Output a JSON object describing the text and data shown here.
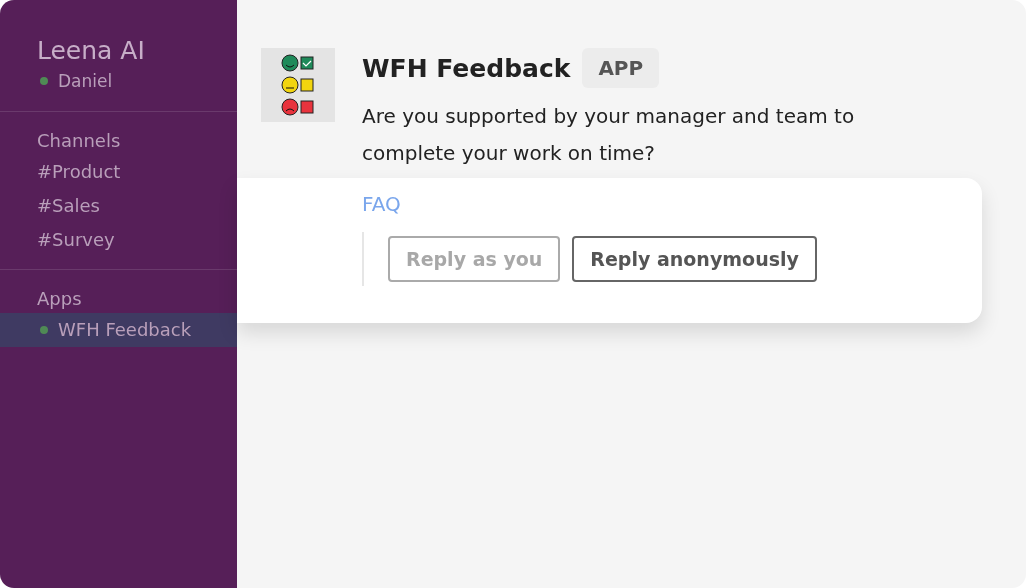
{
  "sidebar": {
    "workspace": "Leena AI",
    "user": {
      "name": "Daniel",
      "online": true
    },
    "sections": [
      {
        "title": "Channels",
        "items": [
          {
            "label": "#Product",
            "selected": false,
            "online": false
          },
          {
            "label": "#Sales",
            "selected": false,
            "online": false
          },
          {
            "label": "#Survey",
            "selected": false,
            "online": false
          }
        ]
      },
      {
        "title": "Apps",
        "items": [
          {
            "label": "WFH Feedback",
            "selected": true,
            "online": true
          }
        ]
      }
    ]
  },
  "message": {
    "sender": "WFH Feedback",
    "badge": "APP",
    "text": "Are you supported by your manager and team to complete your work on time?",
    "link": "FAQ",
    "buttons": [
      {
        "label": "Reply as you",
        "selected": false
      },
      {
        "label": "Reply anonymously",
        "selected": true
      }
    ]
  }
}
